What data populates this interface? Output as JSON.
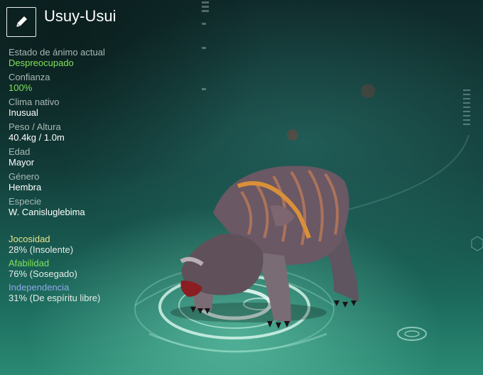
{
  "creature": {
    "name": "Usuy-Usui"
  },
  "icons": {
    "edit": "pencil-icon"
  },
  "stats": [
    {
      "label": "Estado de ánimo actual",
      "value": "Despreocupado",
      "highlight": true
    },
    {
      "label": "Confianza",
      "value": "100%",
      "highlight": true
    },
    {
      "label": "Clima nativo",
      "value": "Inusual",
      "highlight": false
    },
    {
      "label": "Peso / Altura",
      "value": "40.4kg / 1.0m",
      "highlight": false
    },
    {
      "label": "Edad",
      "value": "Mayor",
      "highlight": false
    },
    {
      "label": "Género",
      "value": "Hembra",
      "highlight": false
    },
    {
      "label": "Especie",
      "value": "W. Canisluglebima",
      "highlight": false
    }
  ],
  "traits": [
    {
      "label": "Jocosidad",
      "value": "28% (Insolente)",
      "color": "#e8e48a"
    },
    {
      "label": "Afabilidad",
      "value": "76% (Sosegado)",
      "color": "#7fe35a"
    },
    {
      "label": "Independencia",
      "value": "31% (De espíritu libre)",
      "color": "#8fa8e8"
    }
  ]
}
